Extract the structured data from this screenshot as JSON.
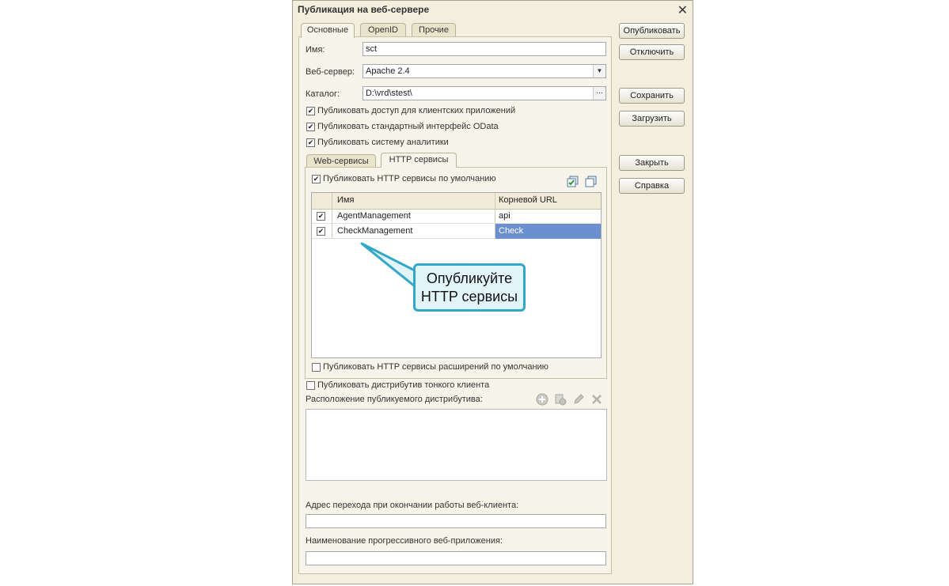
{
  "window": {
    "title": "Публикация на веб-сервере"
  },
  "tabs": [
    "Основные",
    "OpenID",
    "Прочие"
  ],
  "form": {
    "name_label": "Имя:",
    "name_value": "sct",
    "webserver_label": "Веб-сервер:",
    "webserver_value": "Apache 2.4",
    "catalog_label": "Каталог:",
    "catalog_value": "D:\\vrd\\stest\\",
    "catalog_button": "..."
  },
  "checks": {
    "client_apps": {
      "label": "Публиковать доступ для клиентских приложений",
      "checked": true
    },
    "odata": {
      "label": "Публиковать стандартный интерфейс OData",
      "checked": true
    },
    "analytics": {
      "label": "Публиковать систему аналитики",
      "checked": true
    }
  },
  "subtabs": [
    "Web-сервисы",
    "HTTP сервисы"
  ],
  "http": {
    "publish_default": {
      "label": "Публиковать HTTP сервисы по умолчанию",
      "checked": true
    },
    "columns": [
      "Имя",
      "Корневой URL"
    ],
    "rows": [
      {
        "checked": true,
        "name": "AgentManagement",
        "url": "api"
      },
      {
        "checked": true,
        "name": "CheckManagement",
        "url": "Check"
      }
    ],
    "extensions_default": {
      "label": "Публиковать HTTP сервисы расширений по умолчанию",
      "checked": false
    }
  },
  "thin_client": {
    "label": "Публиковать дистрибутив тонкого клиента",
    "checked": false,
    "location_label": "Расположение публикуемого дистрибутива:"
  },
  "exit_address_label": "Адрес перехода при окончании работы веб-клиента:",
  "pwa_name_label": "Наименование прогрессивного веб-приложения:",
  "buttons": {
    "publish": "Опубликовать",
    "disable": "Отключить",
    "save": "Сохранить",
    "load": "Загрузить",
    "close": "Закрыть",
    "help": "Справка"
  },
  "callout": {
    "line1": "Опубликуйте",
    "line2": "HTTP сервисы",
    "color": "#33a8c6"
  },
  "colors": {
    "dialog_bg": "#f2efdf",
    "selection": "#6b90cf",
    "checkmark": "#222222"
  }
}
